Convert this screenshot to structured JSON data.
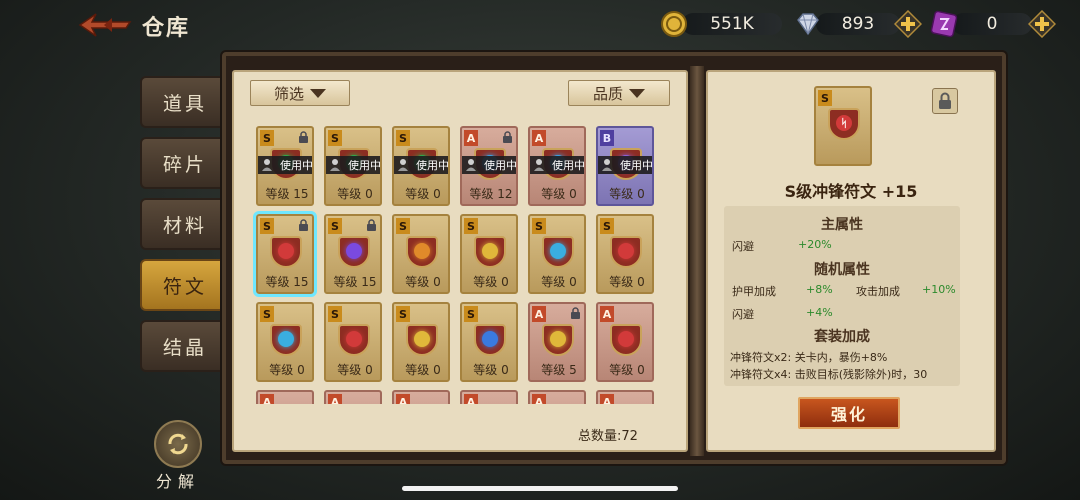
{
  "header": {
    "title": "仓库"
  },
  "resources": [
    {
      "icon": "gold-coin-icon",
      "value": "551K",
      "has_plus": false
    },
    {
      "icon": "diamond-icon",
      "value": "893",
      "has_plus": true
    },
    {
      "icon": "rune-token-icon",
      "value": "0",
      "has_plus": true
    }
  ],
  "sidebar": {
    "tabs": [
      {
        "label": "道具",
        "active": false
      },
      {
        "label": "碎片",
        "active": false
      },
      {
        "label": "材料",
        "active": false
      },
      {
        "label": "符文",
        "active": true
      },
      {
        "label": "结晶",
        "active": false
      }
    ],
    "decompose_label": "分解"
  },
  "inventory": {
    "filter_label": "筛选",
    "quality_label": "品质",
    "inuse_label": "使用中",
    "level_prefix": "等级",
    "total_label": "总数量:72",
    "cards": [
      {
        "quality": "S",
        "locked": true,
        "in_use": true,
        "level": "15",
        "color": "#2fa84a"
      },
      {
        "quality": "S",
        "locked": false,
        "in_use": true,
        "level": "0",
        "color": "#2fa84a"
      },
      {
        "quality": "S",
        "locked": false,
        "in_use": true,
        "level": "0",
        "color": "#2fa84a"
      },
      {
        "quality": "A",
        "locked": true,
        "in_use": true,
        "level": "12",
        "color": "#3aa0e0"
      },
      {
        "quality": "A",
        "locked": false,
        "in_use": true,
        "level": "0",
        "color": "#3aa0e0"
      },
      {
        "quality": "B",
        "locked": false,
        "in_use": true,
        "level": "0",
        "color": "#8a62d6"
      },
      {
        "quality": "S",
        "locked": true,
        "in_use": false,
        "level": "15",
        "color": "#d23a3a",
        "selected": true
      },
      {
        "quality": "S",
        "locked": true,
        "in_use": false,
        "level": "15",
        "color": "#7a4ae0"
      },
      {
        "quality": "S",
        "locked": false,
        "in_use": false,
        "level": "0",
        "color": "#e08a2a"
      },
      {
        "quality": "S",
        "locked": false,
        "in_use": false,
        "level": "0",
        "color": "#e0b83a"
      },
      {
        "quality": "S",
        "locked": false,
        "in_use": false,
        "level": "0",
        "color": "#3aaee0"
      },
      {
        "quality": "S",
        "locked": false,
        "in_use": false,
        "level": "0",
        "color": "#d23a3a"
      },
      {
        "quality": "S",
        "locked": false,
        "in_use": false,
        "level": "0",
        "color": "#3aaee0"
      },
      {
        "quality": "S",
        "locked": false,
        "in_use": false,
        "level": "0",
        "color": "#d23a3a"
      },
      {
        "quality": "S",
        "locked": false,
        "in_use": false,
        "level": "0",
        "color": "#e0b83a"
      },
      {
        "quality": "S",
        "locked": false,
        "in_use": false,
        "level": "0",
        "color": "#3a7ae0"
      },
      {
        "quality": "A",
        "locked": true,
        "in_use": false,
        "level": "5",
        "color": "#e0b83a"
      },
      {
        "quality": "A",
        "locked": false,
        "in_use": false,
        "level": "0",
        "color": "#d23a3a"
      },
      {
        "quality": "A",
        "locked": false,
        "in_use": false,
        "level": "",
        "color": "#d23a3a"
      },
      {
        "quality": "A",
        "locked": false,
        "in_use": false,
        "level": "",
        "color": "#d23a3a"
      },
      {
        "quality": "A",
        "locked": false,
        "in_use": false,
        "level": "",
        "color": "#d23a3a"
      },
      {
        "quality": "A",
        "locked": false,
        "in_use": false,
        "level": "",
        "color": "#d23a3a"
      },
      {
        "quality": "A",
        "locked": false,
        "in_use": false,
        "level": "",
        "color": "#d23a3a"
      },
      {
        "quality": "A",
        "locked": false,
        "in_use": false,
        "level": "",
        "color": "#d23a3a"
      }
    ]
  },
  "detail": {
    "quality": "S",
    "title": "S级冲锋符文 +15",
    "main_header": "主属性",
    "main_stats": [
      {
        "name": "闪避",
        "value": "+20%"
      }
    ],
    "random_header": "随机属性",
    "random_stats": [
      {
        "name": "护甲加成",
        "value": "+8%"
      },
      {
        "name": "攻击加成",
        "value": "+10%"
      },
      {
        "name": "闪避",
        "value": "+4%"
      }
    ],
    "set_header": "套装加成",
    "set_lines": [
      "冲锋符文x2: 关卡内，暴伤+8%",
      "冲锋符文x4: 击败目标(残影除外)时，30"
    ],
    "enhance_label": "强化"
  }
}
